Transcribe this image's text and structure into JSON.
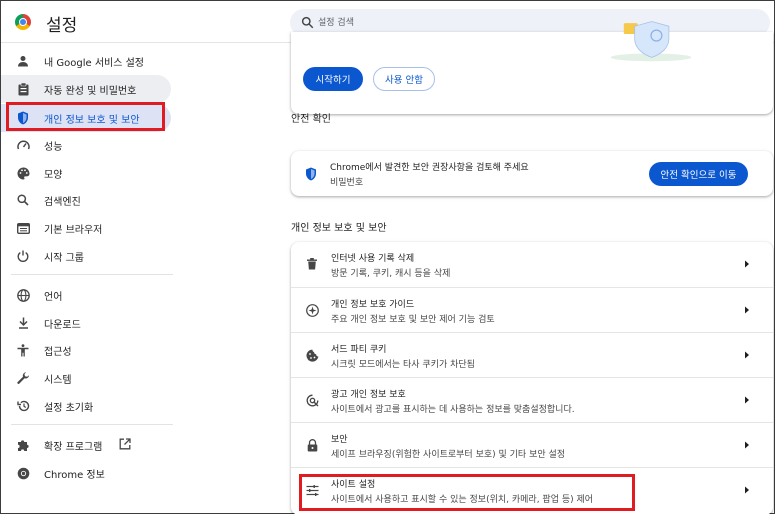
{
  "header": {
    "title": "설정",
    "search_placeholder": "설정 검색"
  },
  "sidebar": {
    "items": [
      {
        "label": "내 Google 서비스 설정",
        "icon": "person-icon"
      },
      {
        "label": "자동 완성 및 비밀번호",
        "icon": "clipboard-icon"
      },
      {
        "label": "개인 정보 보호 및 보안",
        "icon": "shield-icon"
      },
      {
        "label": "성능",
        "icon": "speedometer-icon"
      },
      {
        "label": "모양",
        "icon": "palette-icon"
      },
      {
        "label": "검색엔진",
        "icon": "search-icon"
      },
      {
        "label": "기본 브라우저",
        "icon": "browser-icon"
      },
      {
        "label": "시작 그룹",
        "icon": "power-icon"
      },
      {
        "label": "언어",
        "icon": "globe-icon"
      },
      {
        "label": "다운로드",
        "icon": "download-icon"
      },
      {
        "label": "접근성",
        "icon": "accessibility-icon"
      },
      {
        "label": "시스템",
        "icon": "wrench-icon"
      },
      {
        "label": "설정 초기화",
        "icon": "reset-icon"
      },
      {
        "label": "확장 프로그램",
        "icon": "puzzle-icon"
      },
      {
        "label": "Chrome 정보",
        "icon": "chrome-icon"
      }
    ],
    "active_index": 2
  },
  "promo": {
    "start_label": "시작하기",
    "guide_label": "사용 안함"
  },
  "safety_check": {
    "section_title": "안전 확인",
    "title": "Chrome에서 발견한 보안 권장사항을 검토해 주세요",
    "subtitle": "비밀번호",
    "button_label": "안전 확인으로 이동"
  },
  "privacy": {
    "section_title": "개인 정보 보호 및 보안",
    "rows": [
      {
        "title": "인터넷 사용 기록 삭제",
        "desc": "방문 기록, 쿠키, 캐시 등을 삭제",
        "icon": "trash-icon"
      },
      {
        "title": "개인 정보 보호 가이드",
        "desc": "주요 개인 정보 보호 및 보안 제어 기능 검토",
        "icon": "compass-icon"
      },
      {
        "title": "서드 파티 쿠키",
        "desc": "시크릿 모드에서는 타사 쿠키가 차단됨",
        "icon": "cookie-icon"
      },
      {
        "title": "광고 개인 정보 보호",
        "desc": "사이트에서 광고를 표시하는 데 사용하는 정보를 맞춤설정합니다.",
        "icon": "ad-privacy-icon"
      },
      {
        "title": "보안",
        "desc": "세이프 브라우징(위험한 사이트로부터 보호) 및 기타 보안 설정",
        "icon": "lock-icon"
      },
      {
        "title": "사이트 설정",
        "desc": "사이트에서 사용하고 표시할 수 있는 정보(위치, 카메라, 팝업 등) 제어",
        "icon": "tune-icon"
      }
    ]
  },
  "colors": {
    "accent": "#0b57d0",
    "highlight_box": "#e01b22",
    "active_nav_bg": "#dde3f4"
  }
}
